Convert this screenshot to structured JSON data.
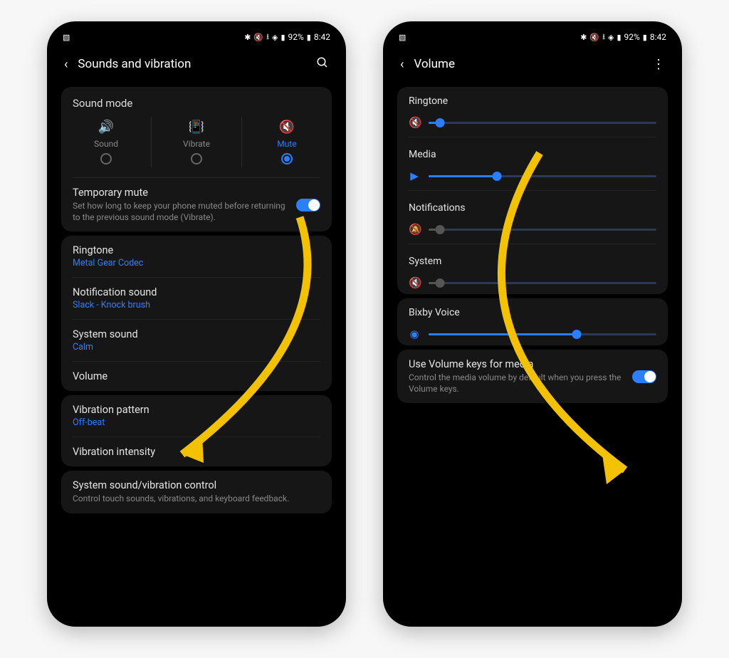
{
  "status": {
    "pct": "92%",
    "time": "8:42"
  },
  "colors": {
    "accent": "#2a7fff",
    "arrow": "#f2c200"
  },
  "left": {
    "title": "Sounds and vibration",
    "sound_mode": {
      "heading": "Sound mode",
      "options": [
        "Sound",
        "Vibrate",
        "Mute"
      ],
      "selected": "Mute"
    },
    "temp_mute": {
      "label": "Temporary mute",
      "desc": "Set how long to keep your phone muted before returning to the previous sound mode (Vibrate).",
      "on": true
    },
    "ringtone": {
      "label": "Ringtone",
      "value": "Metal Gear Codec"
    },
    "notif_sound": {
      "label": "Notification sound",
      "value": "Slack - Knock brush"
    },
    "system_sound": {
      "label": "System sound",
      "value": "Calm"
    },
    "volume": {
      "label": "Volume"
    },
    "vib_pattern": {
      "label": "Vibration pattern",
      "value": "Off-beat"
    },
    "vib_intensity": {
      "label": "Vibration intensity"
    },
    "sound_vib_ctrl": {
      "label": "System sound/vibration control",
      "desc": "Control touch sounds, vibrations, and keyboard feedback."
    }
  },
  "right": {
    "title": "Volume",
    "sliders": {
      "ringtone": {
        "label": "Ringtone",
        "pct": 5,
        "muted": true
      },
      "media": {
        "label": "Media",
        "pct": 30,
        "muted": false
      },
      "notifications": {
        "label": "Notifications",
        "pct": 5,
        "muted": true
      },
      "system": {
        "label": "System",
        "pct": 5,
        "muted": true
      },
      "bixby": {
        "label": "Bixby Voice",
        "pct": 65,
        "muted": false
      }
    },
    "media_keys": {
      "label": "Use Volume keys for media",
      "desc": "Control the media volume by default when you press the Volume keys.",
      "on": true
    }
  }
}
